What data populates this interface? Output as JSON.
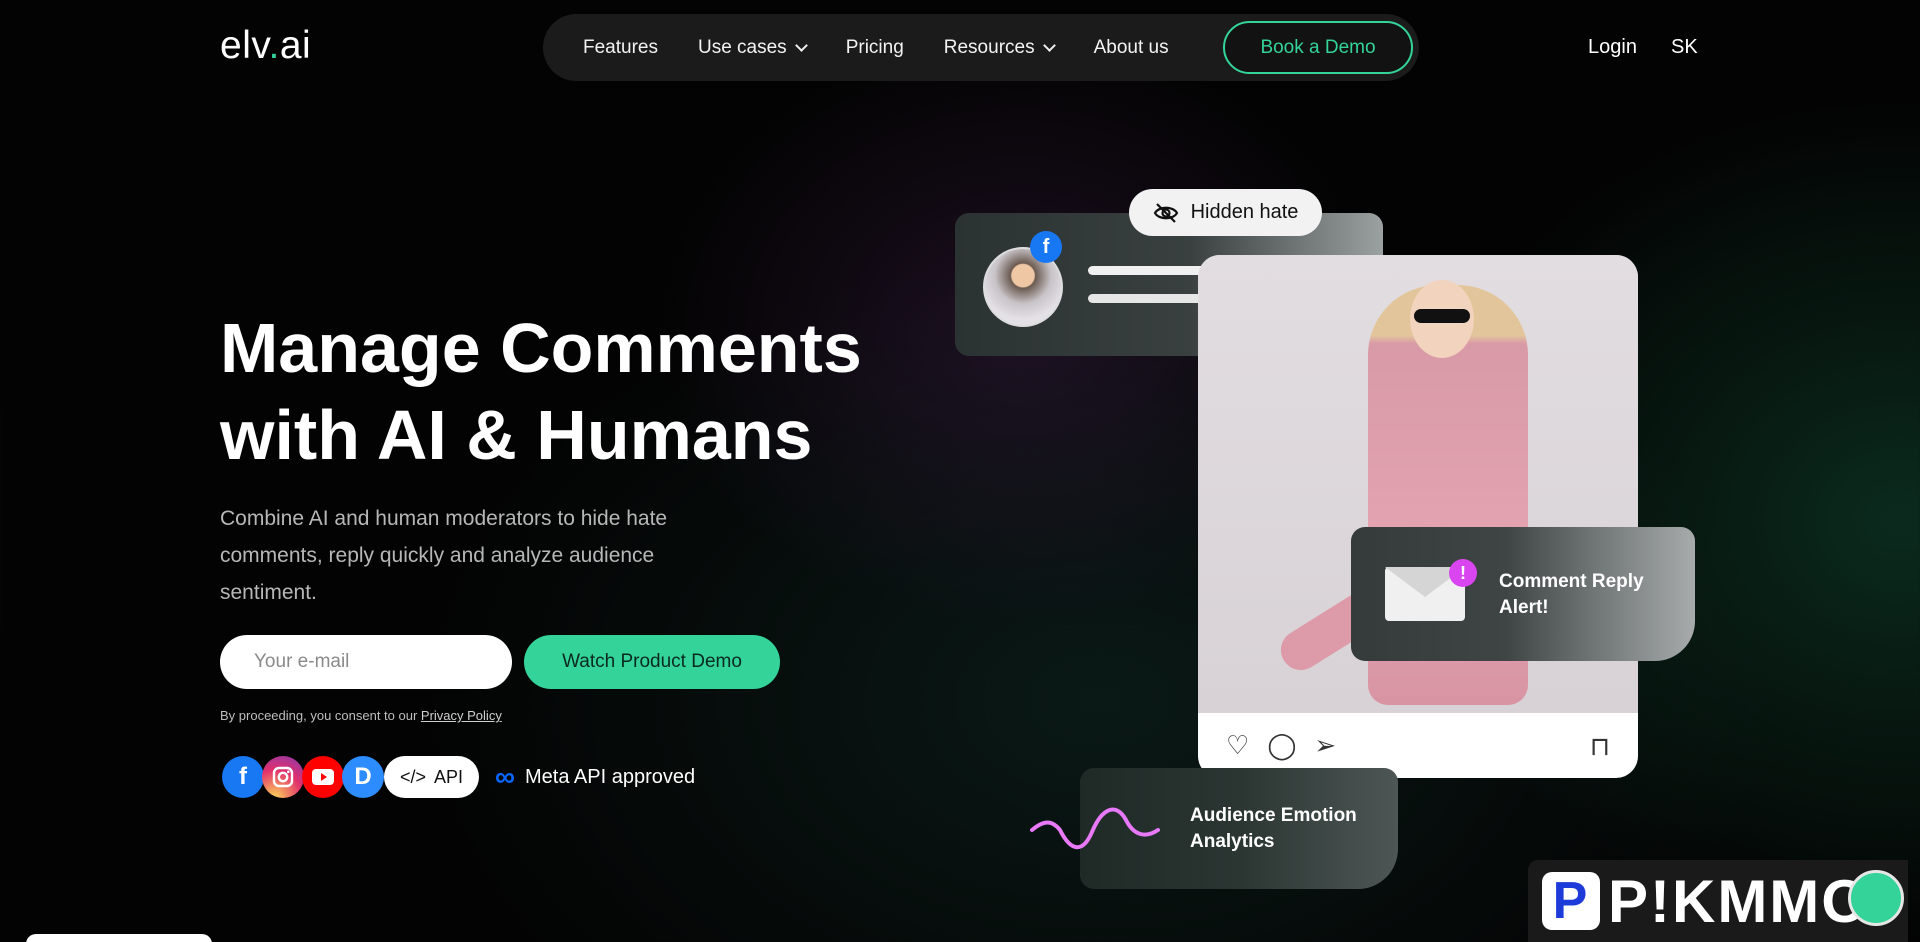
{
  "header": {
    "logo_main": "elv",
    "logo_dot": ".",
    "logo_tail": "ai",
    "nav": [
      {
        "label": "Features"
      },
      {
        "label": "Use cases"
      },
      {
        "label": "Pricing"
      },
      {
        "label": "Resources"
      },
      {
        "label": "About us"
      }
    ],
    "demo_label": "Book a Demo",
    "login_label": "Login",
    "language": "SK"
  },
  "hero": {
    "title_line1": "Manage Comments",
    "title_line2": "with AI & Humans",
    "subtitle": "Combine AI and human moderators to hide hate comments, reply quickly and analyze audience sentiment.",
    "email_placeholder": "Your e-mail",
    "watch_label": "Watch Product Demo",
    "consent_text": "By proceeding, you consent to our ",
    "privacy_label": "Privacy Policy",
    "api_label": "API",
    "meta_label": "Meta API approved"
  },
  "visual": {
    "hidden_hate": "Hidden hate",
    "alert_text": "Comment Reply Alert!",
    "emotion_text": "Audience Emotion Analytics"
  },
  "watermark": {
    "p": "P",
    "text": "P!KMMO"
  },
  "colors": {
    "accent": "#34d399",
    "facebook": "#1877f2",
    "alert": "#d946ef",
    "wave": "#e879f9"
  }
}
